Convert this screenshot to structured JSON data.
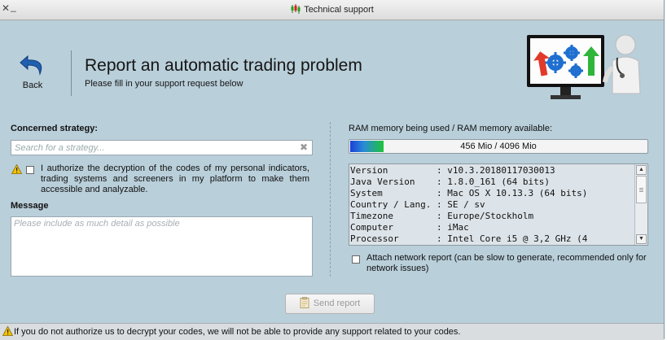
{
  "window": {
    "title": "Technical support",
    "close_glyph": "✕",
    "minimize_glyph": "_"
  },
  "header": {
    "back_label": "Back",
    "title": "Report an automatic trading problem",
    "subtitle": "Please fill in your support request below"
  },
  "strategy": {
    "label": "Concerned strategy:",
    "placeholder": "Search for a strategy...",
    "value": "",
    "clear_glyph": "✖"
  },
  "authorization": {
    "checked": false,
    "text": "I authorize the decryption of the codes of my personal indicators, trading systems and screeners in my platform to make them accessible and analyzable."
  },
  "message": {
    "label": "Message",
    "placeholder": "Please include as much detail as possible",
    "value": ""
  },
  "ram": {
    "label": "RAM memory being used / RAM memory available:",
    "text": "456 Mio / 4096 Mio",
    "used": 456,
    "available": 4096
  },
  "system_info": [
    {
      "key": "Version",
      "value": "v10.3.20180117030013"
    },
    {
      "key": "Java Version",
      "value": "1.8.0_161 (64 bits)"
    },
    {
      "key": "System",
      "value": "Mac OS X 10.13.3 (64 bits)"
    },
    {
      "key": "Country / Lang.",
      "value": "SE / sv"
    },
    {
      "key": "Timezone",
      "value": "Europe/Stockholm"
    },
    {
      "key": "Computer",
      "value": "iMac"
    },
    {
      "key": "Processor",
      "value": "Intel Core i5 @ 3,2 GHz (4"
    }
  ],
  "attach": {
    "checked": false,
    "text": "Attach network report (can be slow to generate, recommended only for network issues)"
  },
  "send_button": {
    "label": "Send report",
    "enabled": false
  },
  "status_bar": {
    "text": "If you do not authorize us to decrypt your codes, we will not be able to provide any support related to your codes."
  },
  "colors": {
    "window_bg": "#b9cfda",
    "warning_yellow": "#f2c200",
    "back_arrow_blue": "#1f5fb0"
  },
  "icons": {
    "title": "candlestick-chart-icon",
    "back": "curved-back-arrow-icon",
    "warning": "warning-triangle-icon",
    "send": "report-document-icon",
    "illustration": "support-technician-monitor-icon"
  }
}
